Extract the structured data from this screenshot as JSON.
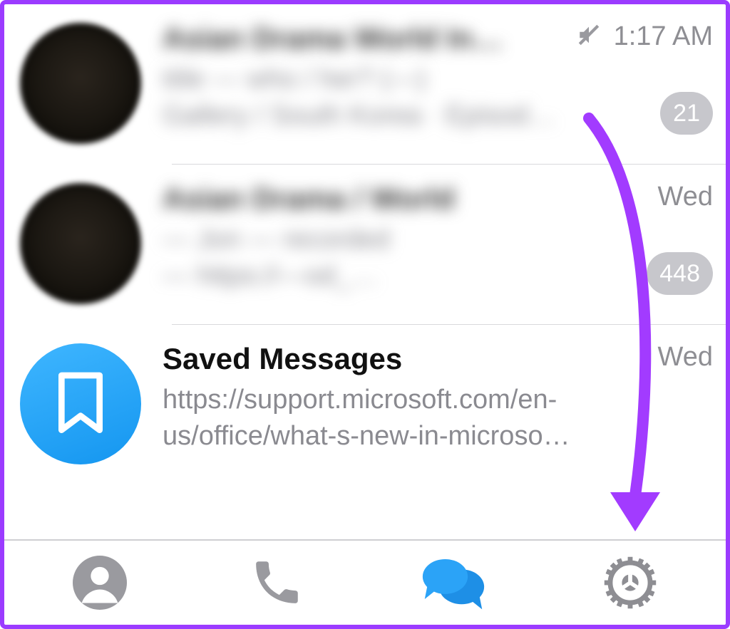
{
  "chats": [
    {
      "title": "Asian Drama World In…",
      "preview_line1": "title — who / her? (—)",
      "preview_line2": "Gallery / South Korea · Episod…",
      "time": "1:17 AM",
      "muted": true,
      "unread": "21"
    },
    {
      "title": "Asian Drama / World",
      "preview_line1": "— Jon — recorded",
      "preview_line2": "— https://—od_…",
      "time": "Wed",
      "muted": false,
      "unread": "448"
    },
    {
      "title": "Saved Messages",
      "preview_line1": "https://support.microsoft.com/en-",
      "preview_line2": "us/office/what-s-new-in-microso…",
      "time": "Wed",
      "muted": false,
      "unread": ""
    }
  ],
  "tabs": {
    "contacts": "Contacts",
    "calls": "Calls",
    "chats": "Chats",
    "settings": "Settings"
  },
  "annotation": {
    "target": "settings-tab"
  }
}
